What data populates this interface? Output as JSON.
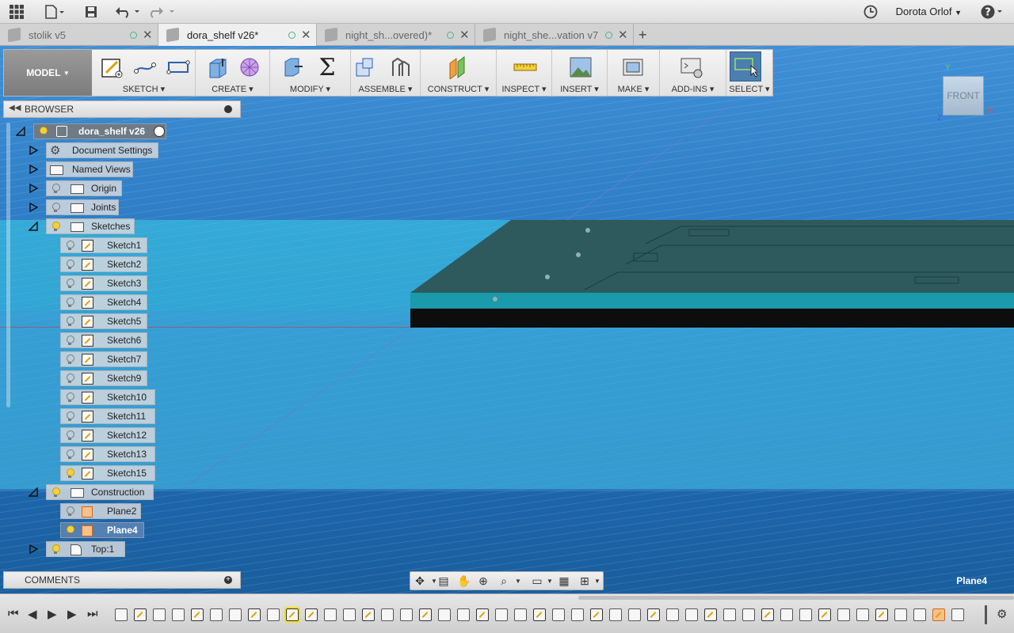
{
  "topbar": {
    "apps_icon": "grid-icon",
    "file_icon": "file-icon",
    "save_icon": "save-icon",
    "undo_icon": "undo-icon",
    "redo_icon": "redo-icon",
    "history_icon": "clock-icon",
    "user_name": "Dorota Orlof",
    "help_icon": "help-icon"
  },
  "tabs": [
    {
      "label": "stolik v5",
      "active": false
    },
    {
      "label": "dora_shelf v26*",
      "active": true
    },
    {
      "label": "night_sh...overed)*",
      "active": false
    },
    {
      "label": "night_she...vation v7",
      "active": false
    }
  ],
  "toolbar": {
    "workspace": "MODEL",
    "groups": [
      {
        "label": "SKETCH"
      },
      {
        "label": "CREATE"
      },
      {
        "label": "MODIFY"
      },
      {
        "label": "ASSEMBLE"
      },
      {
        "label": "CONSTRUCT"
      },
      {
        "label": "INSPECT"
      },
      {
        "label": "INSERT"
      },
      {
        "label": "MAKE"
      },
      {
        "label": "ADD-INS"
      },
      {
        "label": "SELECT"
      }
    ]
  },
  "viewcube": {
    "face": "FRONT",
    "axis_y": "Y",
    "axis_z": "Z",
    "axis_x": "X"
  },
  "browser": {
    "title": "BROWSER",
    "root": "dora_shelf v26",
    "items": [
      {
        "label": "Document Settings"
      },
      {
        "label": "Named Views"
      },
      {
        "label": "Origin"
      },
      {
        "label": "Joints"
      },
      {
        "label": "Sketches"
      },
      {
        "label": "Sketch1"
      },
      {
        "label": "Sketch2"
      },
      {
        "label": "Sketch3"
      },
      {
        "label": "Sketch4"
      },
      {
        "label": "Sketch5"
      },
      {
        "label": "Sketch6"
      },
      {
        "label": "Sketch7"
      },
      {
        "label": "Sketch9"
      },
      {
        "label": "Sketch10"
      },
      {
        "label": "Sketch11"
      },
      {
        "label": "Sketch12"
      },
      {
        "label": "Sketch13"
      },
      {
        "label": "Sketch15"
      },
      {
        "label": "Construction"
      },
      {
        "label": "Plane2"
      },
      {
        "label": "Plane4"
      },
      {
        "label": "Top:1"
      }
    ]
  },
  "comments": {
    "title": "COMMENTS"
  },
  "status": {
    "selection": "Plane4"
  },
  "colors": {
    "viewport_bg": "#2a78c4",
    "plane_highlight": "#3cd0e6",
    "model_top": "#2e5a5e",
    "model_side": "#0d0d0d",
    "accent_select": "#4a7fb0"
  }
}
